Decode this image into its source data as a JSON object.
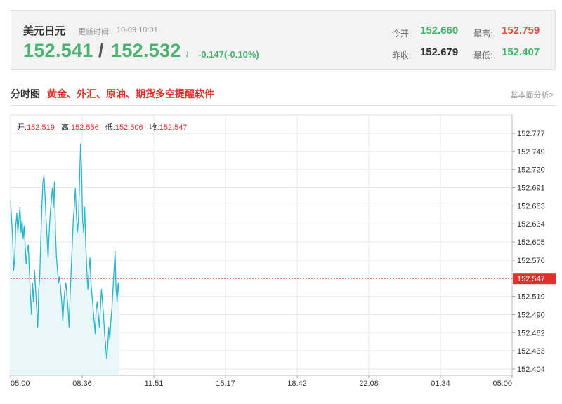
{
  "header": {
    "symbol": "美元日元",
    "update_label": "更新时间:",
    "update_time": "10-09 10:01",
    "bid": "152.541",
    "slash": "/",
    "ask": "152.532",
    "arrow": "↓",
    "change": "-0.147(-0.10%)",
    "stats": {
      "open_label": "今开:",
      "open": "152.660",
      "high_label": "最高:",
      "high": "152.759",
      "prev_close_label": "昨收:",
      "prev_close": "152.679",
      "low_label": "最低:",
      "low": "152.407"
    },
    "colors": {
      "up": "#e2504a",
      "down": "#4cb36f"
    }
  },
  "section": {
    "title": "分时图",
    "promo": "黄金、外汇、原油、期货多空提醒软件",
    "fundamental_link": "基本面分析>"
  },
  "ohlc_bar": {
    "open_label": "开:",
    "open": "152.519",
    "high_label": "高:",
    "high": "152.556",
    "low_label": "低:",
    "low": "152.506",
    "close_label": "收:",
    "close": "152.547"
  },
  "chart_data": {
    "type": "area",
    "x_ticks": [
      "05:00",
      "08:36",
      "11:51",
      "15:17",
      "18:42",
      "22:08",
      "01:34",
      "05:00"
    ],
    "y_ticks": [
      "152.777",
      "152.749",
      "152.720",
      "152.691",
      "152.663",
      "152.634",
      "152.605",
      "152.576",
      "152.547",
      "152.519",
      "152.490",
      "152.462",
      "152.433",
      "152.404"
    ],
    "ylim": [
      152.404,
      152.777
    ],
    "current_price": 152.547,
    "current_price_label": "152.547",
    "session_minutes": 1440,
    "line_color": "#2bb5c8",
    "fill_color": "#eaf7fa",
    "marker_color": "#e0302b",
    "series": [
      {
        "minutes": [
          0,
          3,
          6,
          9,
          12,
          15,
          18,
          21,
          24,
          27,
          30,
          33,
          36,
          39,
          42,
          45,
          48,
          51,
          54,
          57,
          60,
          63,
          66,
          69,
          72,
          75,
          78,
          81,
          84,
          87,
          90,
          93,
          96,
          99,
          102,
          105,
          108,
          111,
          114,
          117,
          120,
          123,
          126,
          129,
          132,
          135,
          138,
          141,
          144,
          147,
          150,
          153,
          156,
          159,
          162,
          165,
          168,
          171,
          174,
          177,
          180,
          183,
          186,
          189,
          192,
          195,
          198,
          201,
          204,
          207,
          210,
          213,
          216,
          219,
          222,
          225,
          228,
          231,
          234,
          237,
          240,
          243,
          246,
          249,
          252,
          255,
          258,
          261,
          264,
          267,
          270,
          273,
          276,
          279,
          282,
          285,
          288,
          291,
          294,
          297,
          300,
          303,
          306,
          309,
          312
        ],
        "values": [
          152.67,
          152.64,
          152.61,
          152.56,
          152.58,
          152.63,
          152.65,
          152.62,
          152.64,
          152.66,
          152.62,
          152.64,
          152.61,
          152.63,
          152.6,
          152.57,
          152.59,
          152.6,
          152.56,
          152.52,
          152.49,
          152.54,
          152.51,
          152.56,
          152.53,
          152.5,
          152.47,
          152.53,
          152.55,
          152.61,
          152.66,
          152.7,
          152.71,
          152.68,
          152.64,
          152.61,
          152.58,
          152.62,
          152.65,
          152.67,
          152.69,
          152.66,
          152.7,
          152.62,
          152.58,
          152.56,
          152.54,
          152.55,
          152.53,
          152.51,
          152.48,
          152.51,
          152.53,
          152.54,
          152.52,
          152.5,
          152.47,
          152.52,
          152.56,
          152.6,
          152.64,
          152.66,
          152.69,
          152.65,
          152.62,
          152.64,
          152.7,
          152.76,
          152.72,
          152.64,
          152.62,
          152.66,
          152.6,
          152.56,
          152.53,
          152.56,
          152.58,
          152.54,
          152.52,
          152.5,
          152.48,
          152.46,
          152.5,
          152.51,
          152.49,
          152.47,
          152.5,
          152.53,
          152.51,
          152.49,
          152.46,
          152.44,
          152.42,
          152.44,
          152.47,
          152.45,
          152.48,
          152.5,
          152.53,
          152.56,
          152.59,
          152.53,
          152.51,
          152.54,
          152.52
        ]
      }
    ]
  }
}
